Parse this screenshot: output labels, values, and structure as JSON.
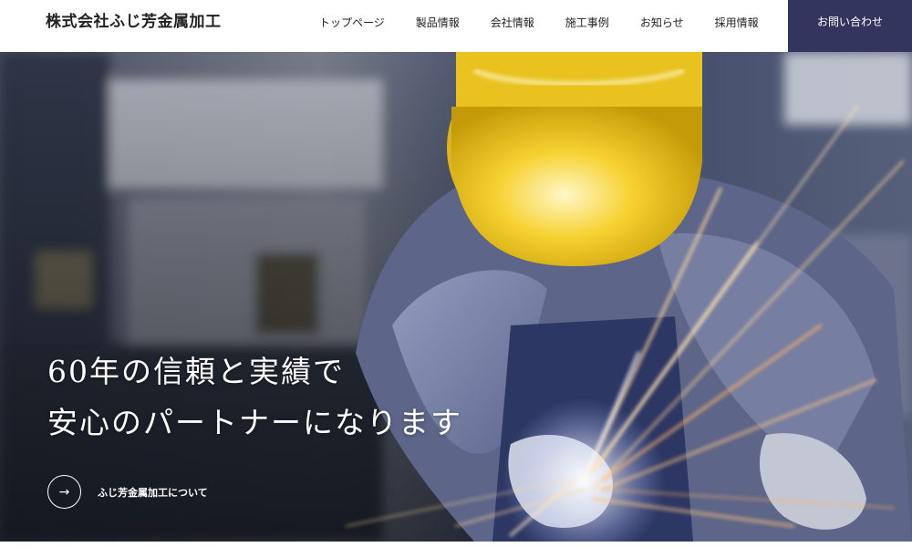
{
  "header": {
    "logo": "株式会社ふじ芳金属加工",
    "nav": [
      {
        "label": "トップページ"
      },
      {
        "label": "製品情報"
      },
      {
        "label": "会社情報"
      },
      {
        "label": "施工事例"
      },
      {
        "label": "お知らせ"
      },
      {
        "label": "採用情報"
      }
    ],
    "contact_label": "お問い合わせ"
  },
  "hero": {
    "headline_line1": "60年の信頼と実績で",
    "headline_line2": "安心のパートナーになります",
    "about_arrow": "→",
    "about_label": "ふじ芳金属加工について"
  },
  "colors": {
    "accent": "#33355e",
    "helmet": "#f2c21a",
    "text": "#222222"
  }
}
